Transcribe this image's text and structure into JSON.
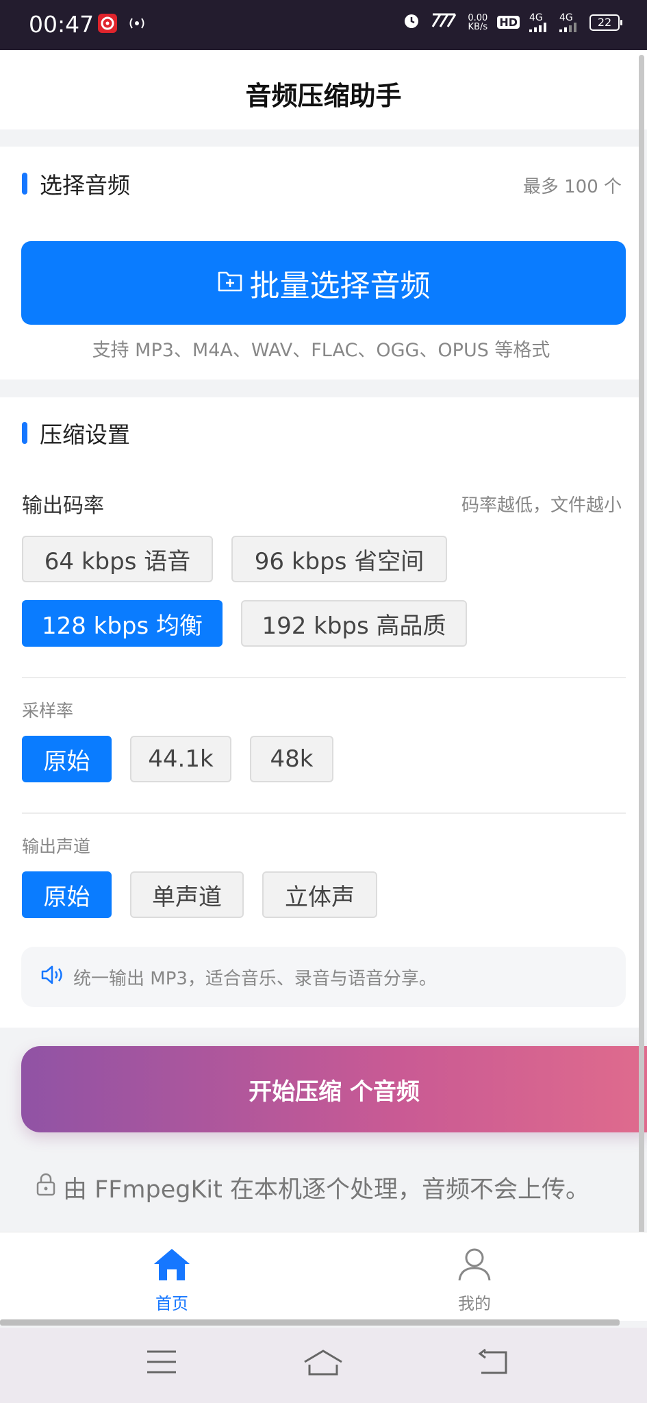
{
  "status_bar": {
    "time": "00:47",
    "speed_value": "0.00",
    "speed_unit": "KB/s",
    "hd_label": "HD",
    "network_1": "4G",
    "network_2": "4G",
    "battery": "22"
  },
  "header": {
    "title": "音频压缩助手"
  },
  "select_section": {
    "title": "选择音频",
    "limit": "最多 100 个",
    "button_label": "批量选择音频",
    "support_text": "支持 MP3、M4A、WAV、FLAC、OGG、OPUS 等格式"
  },
  "compress_section": {
    "title": "压缩设置",
    "bitrate": {
      "label": "输出码率",
      "hint": "码率越低，文件越小",
      "options": [
        "64 kbps 语音",
        "96 kbps 省空间",
        "128 kbps 均衡",
        "192 kbps 高品质"
      ],
      "selected": "128 kbps 均衡"
    },
    "sample_rate": {
      "label": "采样率",
      "options": [
        "原始",
        "44.1k",
        "48k"
      ],
      "selected": "原始"
    },
    "channel": {
      "label": "输出声道",
      "options": [
        "原始",
        "单声道",
        "立体声"
      ],
      "selected": "原始"
    },
    "info_text": "统一输出 MP3，适合音乐、录音与语音分享。"
  },
  "start_button": {
    "label": "开始压缩 个音频"
  },
  "local_note": "由 FFmpegKit 在本机逐个处理，音频不会上传。",
  "tab_bar": {
    "home_label": "首页",
    "me_label": "我的",
    "active": "首页",
    "active_color": "#1677ff"
  },
  "colors": {
    "accent": "#0a7cff",
    "gradient_start": "#9053a5",
    "gradient_end": "#df6b8d"
  }
}
